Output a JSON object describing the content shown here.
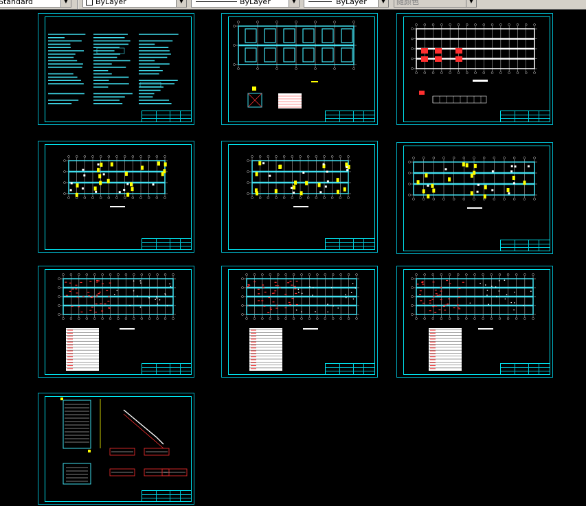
{
  "toolbar": {
    "text_style": "Standard",
    "layer_color": "ByLayer",
    "linetype": "ByLayer",
    "lineweight": "ByLayer",
    "plot_style": "随颜色"
  },
  "sheets": [
    {
      "name": "sheet-general-notes"
    },
    {
      "name": "sheet-foundation-plan"
    },
    {
      "name": "sheet-column-layout"
    },
    {
      "name": "sheet-floor-plan-1"
    },
    {
      "name": "sheet-floor-plan-2"
    },
    {
      "name": "sheet-floor-plan-3"
    },
    {
      "name": "sheet-slab-rebar-1"
    },
    {
      "name": "sheet-slab-rebar-2"
    },
    {
      "name": "sheet-slab-rebar-3"
    },
    {
      "name": "sheet-stair-details"
    }
  ],
  "colors": {
    "background": "#000000",
    "frame": "#00e4f0",
    "drawing": "#40e0f0",
    "highlight": "#ffff00",
    "rebar": "#ff3030",
    "text": "#ffffff"
  }
}
